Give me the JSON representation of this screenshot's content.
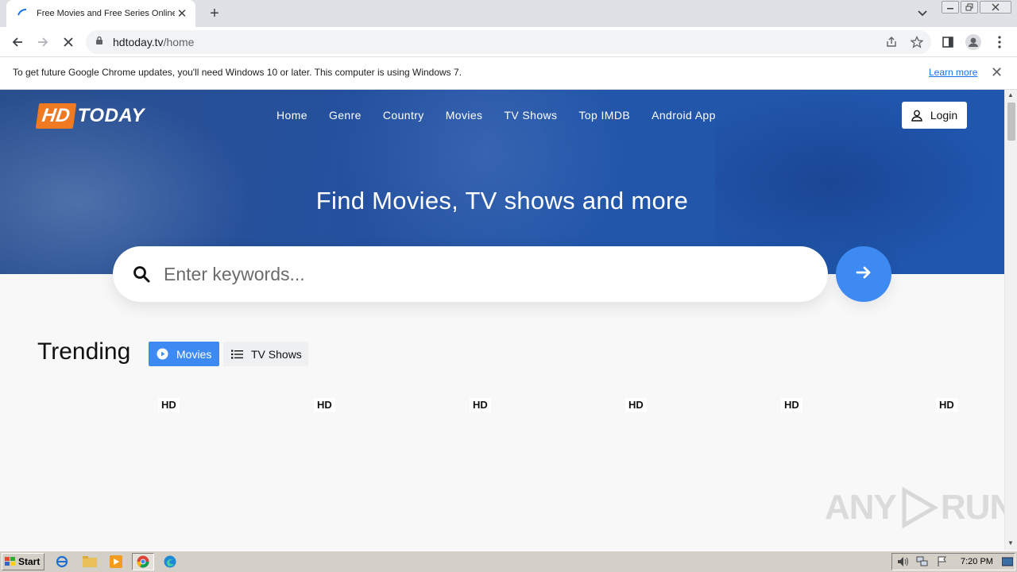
{
  "browser": {
    "tab_title": "Free Movies and Free Series Online",
    "url_host": "hdtoday.tv",
    "url_path": "/home",
    "infobar_message": "To get future Google Chrome updates, you'll need Windows 10 or later. This computer is using Windows 7.",
    "infobar_link": "Learn more"
  },
  "site": {
    "logo_hd": "HD",
    "logo_today": "TODAY",
    "nav": [
      "Home",
      "Genre",
      "Country",
      "Movies",
      "TV Shows",
      "Top IMDB",
      "Android App"
    ],
    "login_label": "Login",
    "hero_title": "Find Movies, TV shows and more",
    "search_placeholder": "Enter keywords...",
    "trending_title": "Trending",
    "tabs": {
      "movies": "Movies",
      "tv_shows": "TV Shows"
    },
    "badges": [
      "HD",
      "HD",
      "HD",
      "HD",
      "HD",
      "HD"
    ],
    "accent_color": "#3d8bf2",
    "logo_orange": "#f07a22"
  },
  "watermark": {
    "left": "ANY",
    "right": "RUN"
  },
  "taskbar": {
    "start_label": "Start",
    "clock": "7:20 PM"
  }
}
